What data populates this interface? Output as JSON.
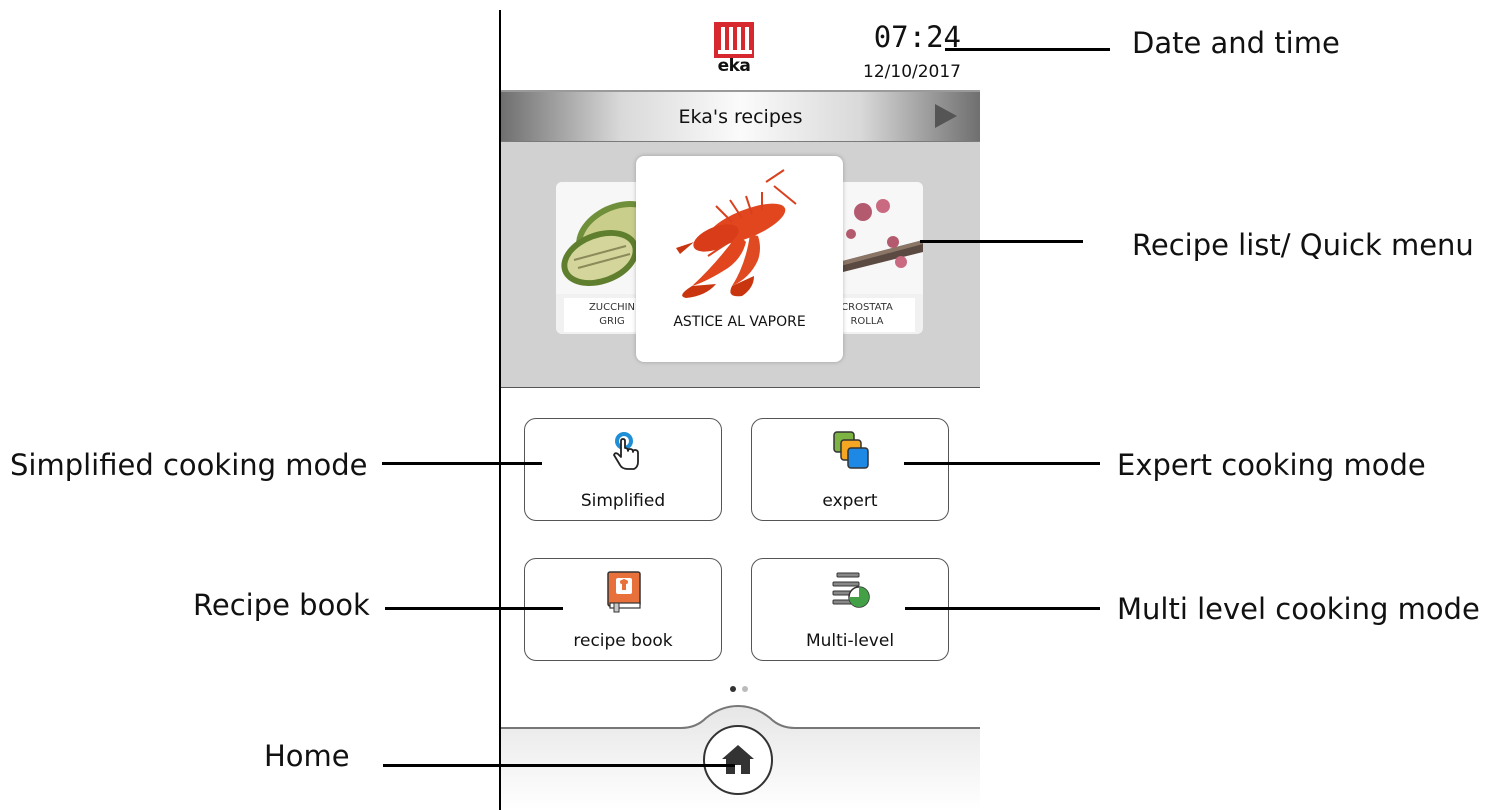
{
  "header": {
    "logo_text": "eka",
    "time": "07:24",
    "date": "12/10/2017"
  },
  "banner": {
    "title": "Eka's recipes"
  },
  "carousel": {
    "left_card": {
      "label_line1": "ZUCCHIN",
      "label_line2": "GRIG"
    },
    "center_card": {
      "label": "ASTICE AL VAPORE"
    },
    "right_card": {
      "label_line1": "CROSTATA",
      "label_line2": "ROLLA"
    }
  },
  "modes": {
    "simplified": {
      "label": "Simplified",
      "icon": "hand-tap-icon"
    },
    "expert": {
      "label": "expert",
      "icon": "stacked-squares-icon"
    },
    "recipe_book": {
      "label": "recipe book",
      "icon": "book-icon"
    },
    "multilevel": {
      "label": "Multi-level",
      "icon": "trays-timer-icon"
    }
  },
  "pager": {
    "current": 1,
    "total": 2
  },
  "callouts": {
    "date_time": "Date and time",
    "recipe_list": "Recipe list/ Quick menu",
    "simplified": "Simplified cooking mode",
    "expert": "Expert cooking mode",
    "recipe_book": "Recipe book",
    "multilevel": "Multi level cooking mode",
    "home": "Home"
  },
  "colors": {
    "brand_red": "#d7282f",
    "tap_blue": "#1e8fd6",
    "expert_green": "#7cb342",
    "expert_orange": "#f5a623",
    "expert_blue": "#1e88e5",
    "book_orange": "#e8703a",
    "timer_green": "#43a047"
  }
}
